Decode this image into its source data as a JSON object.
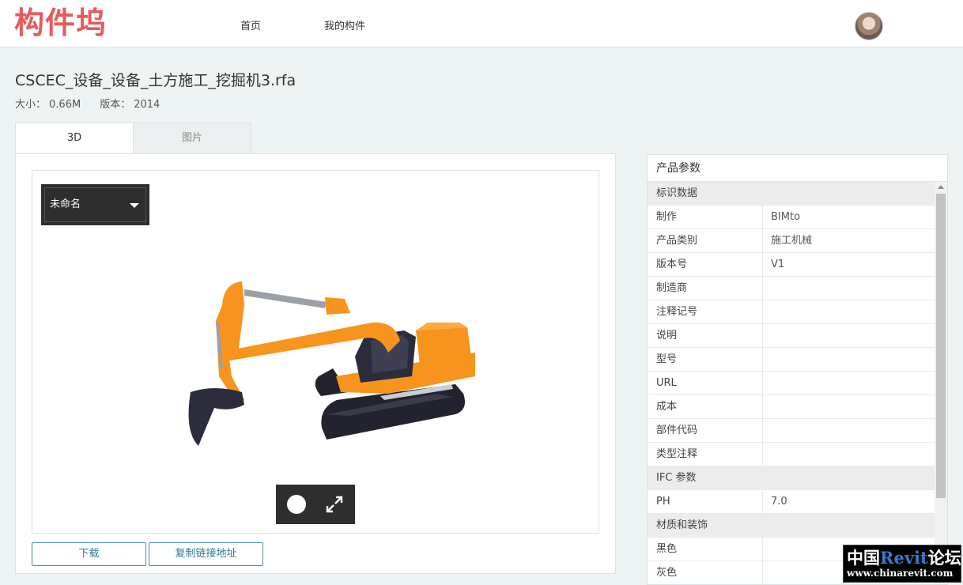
{
  "header": {
    "logo_text": "构件坞",
    "nav": {
      "home": "首页",
      "my_components": "我的构件"
    }
  },
  "file": {
    "name": "CSCEC_设备_设备_土方施工_挖掘机3.rfa",
    "size_label": "大小：",
    "size_value": "0.66M",
    "version_label": "版本：",
    "version_value": "2014"
  },
  "tabs": {
    "tab_3d": "3D",
    "tab_images": "图片",
    "active": "3D"
  },
  "viewer": {
    "view_select": "未命名",
    "model_colors": {
      "body": "#f7941d",
      "cab": "#2b2d3c",
      "track": "#22232e",
      "arm_rod": "#9aa0a6"
    }
  },
  "actions": {
    "download": "下载",
    "copy_link": "复制链接地址"
  },
  "params": {
    "title": "产品参数",
    "groups": [
      {
        "label": "标识数据"
      },
      {
        "label": "IFC 参数"
      },
      {
        "label": "材质和装饰"
      }
    ],
    "identity": [
      {
        "key": "制作",
        "value": "BIMto"
      },
      {
        "key": "产品类别",
        "value": "施工机械"
      },
      {
        "key": "版本号",
        "value": "V1"
      },
      {
        "key": "制造商",
        "value": ""
      },
      {
        "key": "注释记号",
        "value": ""
      },
      {
        "key": "说明",
        "value": ""
      },
      {
        "key": "型号",
        "value": ""
      },
      {
        "key": "URL",
        "value": ""
      },
      {
        "key": "成本",
        "value": ""
      },
      {
        "key": "部件代码",
        "value": ""
      },
      {
        "key": "类型注释",
        "value": ""
      }
    ],
    "ifc": [
      {
        "key": "PH",
        "value": "7.0"
      }
    ],
    "material": [
      {
        "key": "黑色",
        "value": ""
      },
      {
        "key": "灰色",
        "value": ""
      }
    ]
  },
  "watermark": {
    "cn1": "中国",
    "rv": "Revit",
    "cn2": "论坛",
    "url": "www.chinarevit.com"
  }
}
